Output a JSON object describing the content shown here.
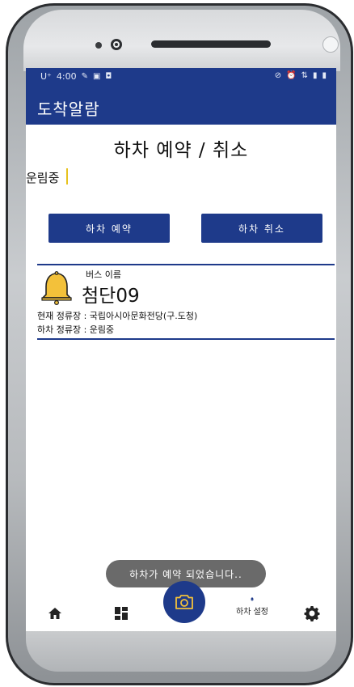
{
  "status_bar": {
    "carrier": "U⁺",
    "time": "4:00",
    "right_icons": [
      "signal-off-icon",
      "alarm-icon",
      "lte-icon",
      "signal-icon",
      "battery-icon"
    ]
  },
  "app": {
    "title": "도착알람"
  },
  "page": {
    "title": "하차 예약 / 취소",
    "stop_input_value": "운림중"
  },
  "buttons": {
    "reserve_label": "하차 예약",
    "cancel_label": "하차 취소"
  },
  "bus_card": {
    "name_label": "버스 이름",
    "bus_name": "첨단09",
    "current_stop": "현재 정류장 : 국립아시아문화전당(구.도청)",
    "drop_stop": "하차 정류장 : 운림중"
  },
  "toast": {
    "message": "하차가 예약 되었습니다.."
  },
  "bottom_nav": {
    "items": [
      {
        "icon": "home-icon"
      },
      {
        "icon": "dashboard-icon"
      },
      {
        "icon": "bell-icon",
        "label": "하차 설정"
      },
      {
        "icon": "gear-icon"
      }
    ],
    "fab_icon": "camera-icon"
  },
  "colors": {
    "primary": "#1e3a8a",
    "bell": "#f3c13a",
    "toast_bg": "#6a6a6a"
  }
}
